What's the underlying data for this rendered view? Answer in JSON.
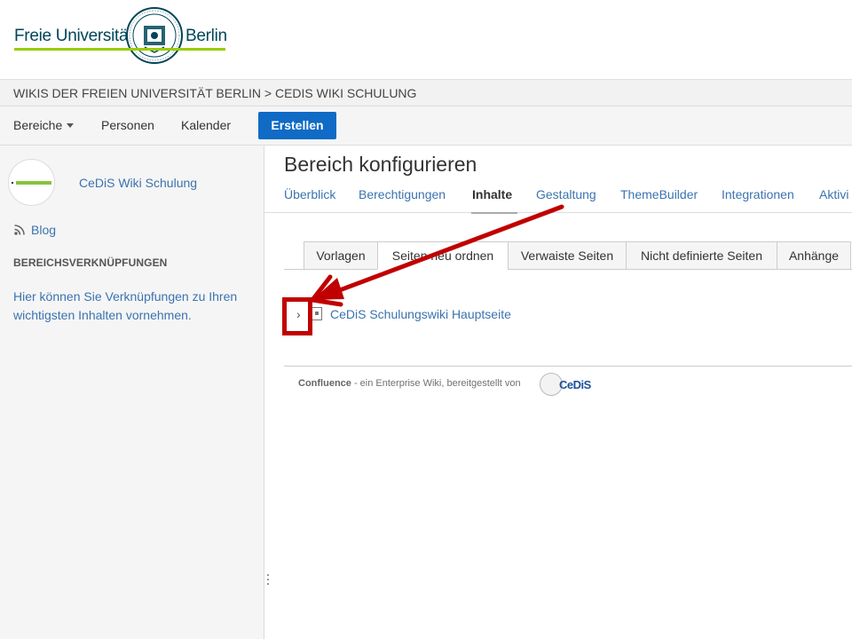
{
  "header": {
    "logo_left": "Freie Universität",
    "logo_right": "Berlin"
  },
  "breadcrumb": "WIKIS DER FREIEN UNIVERSITÄT BERLIN > CEDIS WIKI SCHULUNG",
  "nav": {
    "items": [
      "Bereiche",
      "Personen",
      "Kalender"
    ],
    "create_label": "Erstellen"
  },
  "sidebar": {
    "space_name": "CeDiS Wiki Schulung",
    "blog_label": "Blog",
    "links_heading": "BEREICHSVERKNÜPFUNGEN",
    "links_text": "Hier können Sie Verknüpfungen zu Ihren wichtigsten Inhalten vornehmen."
  },
  "main": {
    "title": "Bereich konfigurieren",
    "admin_tabs": [
      "Überblick",
      "Berechtigungen",
      "Inhalte",
      "Gestaltung",
      "ThemeBuilder",
      "Integrationen",
      "Aktivi"
    ],
    "active_admin_tab": "Inhalte",
    "sub_tabs": [
      "Vorlagen",
      "Seiten neu ordnen",
      "Verwaiste Seiten",
      "Nicht definierte Seiten",
      "Anhänge"
    ],
    "active_sub_tab": "Seiten neu ordnen",
    "tree_toggle": "›",
    "tree_page": "CeDiS Schulungswiki Hauptseite"
  },
  "footer": {
    "brand": "Confluence",
    "text": " - ein Enterprise Wiki, bereitgestellt von",
    "logo_text": "CeDiS"
  },
  "colors": {
    "link": "#3b73af",
    "create_button": "#0f6bc5",
    "annotation": "#c00000",
    "fu_green": "#99cc00",
    "fu_blue": "#004659"
  }
}
